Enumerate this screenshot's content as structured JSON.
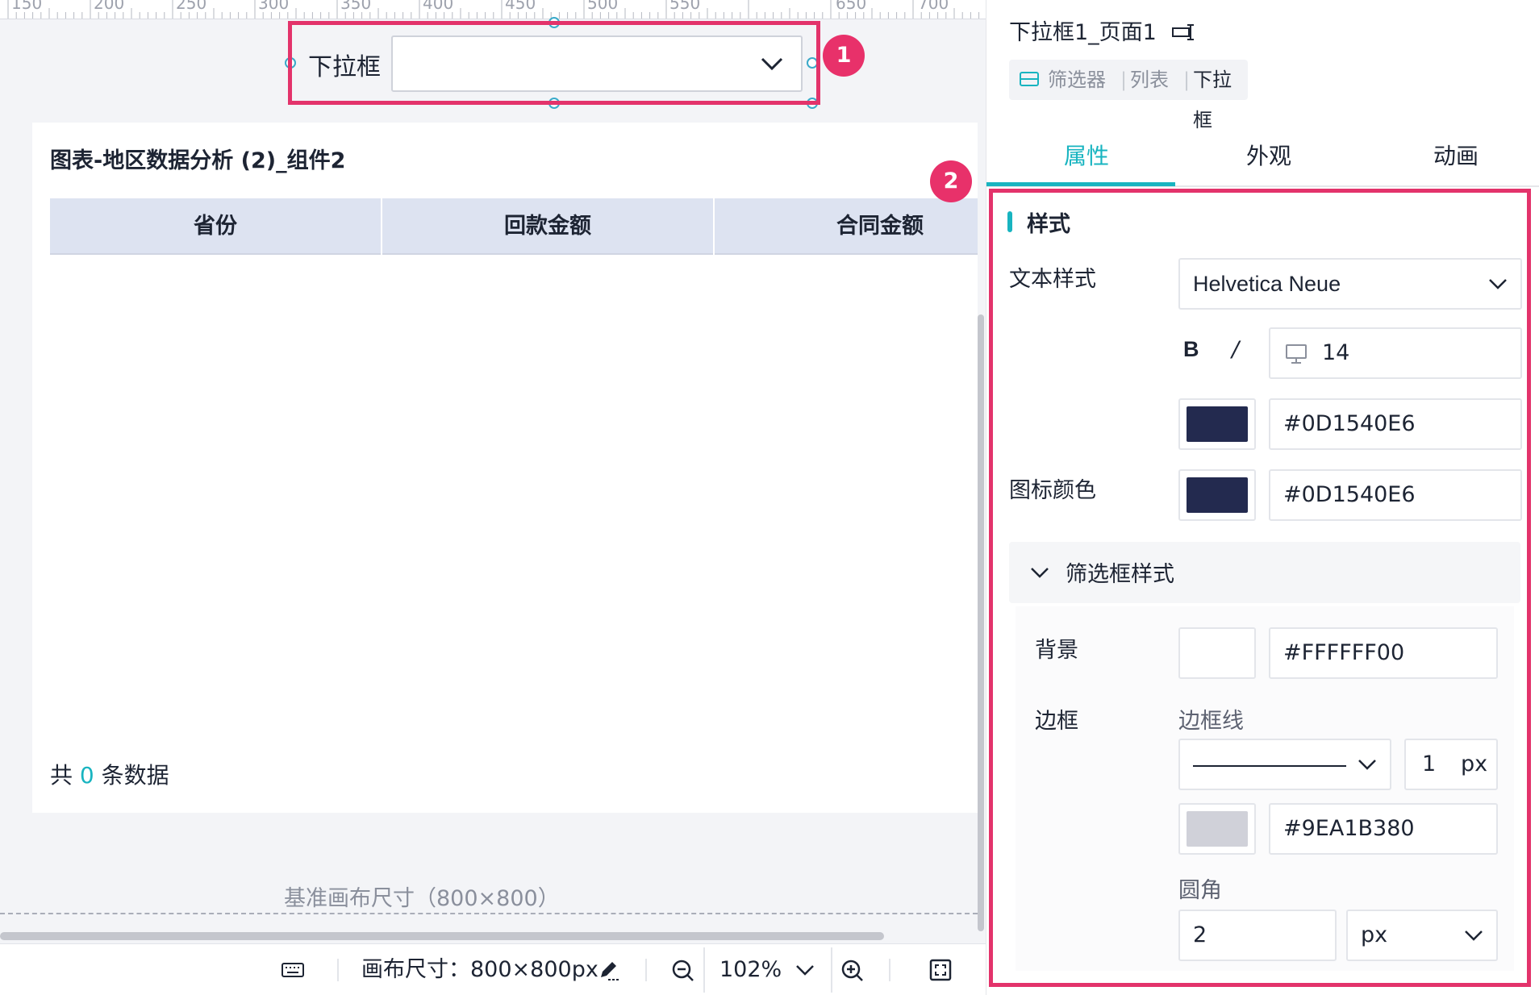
{
  "ruler": {
    "labels": [
      "150",
      "200",
      "250",
      "300",
      "350",
      "400",
      "450",
      "500",
      "550",
      "650",
      "700"
    ]
  },
  "canvas": {
    "filter_component": {
      "label": "下拉框",
      "value": ""
    },
    "badges": {
      "first": "1",
      "second": "2"
    },
    "table_widget": {
      "title": "图表-地区数据分析 (2)_组件2",
      "columns": [
        "省份",
        "回款金额",
        "合同金额"
      ],
      "rows": [],
      "count_prefix": "共",
      "count_value": "0",
      "count_suffix": "条数据"
    },
    "base_size": "基准画布尺寸（800×800）"
  },
  "bottom_bar": {
    "canvas_size": "画布尺寸：800×800px",
    "zoom": "102%"
  },
  "panel": {
    "component_name": "下拉框1_页面1",
    "breadcrumb": [
      "筛选器",
      "列表",
      "下拉框"
    ],
    "tabs": [
      {
        "label": "属性",
        "active": true
      },
      {
        "label": "外观",
        "active": false
      },
      {
        "label": "动画",
        "active": false
      }
    ],
    "section_title": "样式",
    "text_style": {
      "label": "文本样式",
      "font": "Helvetica Neue",
      "bold": "B",
      "italic": "/",
      "size": "14",
      "color": "#0D1540E6"
    },
    "icon_color": {
      "label": "图标颜色",
      "color": "#0D1540E6"
    },
    "filter_box_style": {
      "title": "筛选框样式",
      "background": {
        "label": "背景",
        "color": "#FFFFFF00"
      },
      "border": {
        "label": "边框",
        "line_label": "边框线",
        "width": "1",
        "width_unit": "px",
        "color": "#9EA1B380"
      },
      "radius": {
        "label": "圆角",
        "value": "2",
        "unit": "px"
      }
    }
  },
  "colors": {
    "accent": "#18b4c0",
    "annotation": "#e3336b",
    "text_color_swatch": "#232a4f",
    "border_color_swatch": "#d0d1d9"
  }
}
